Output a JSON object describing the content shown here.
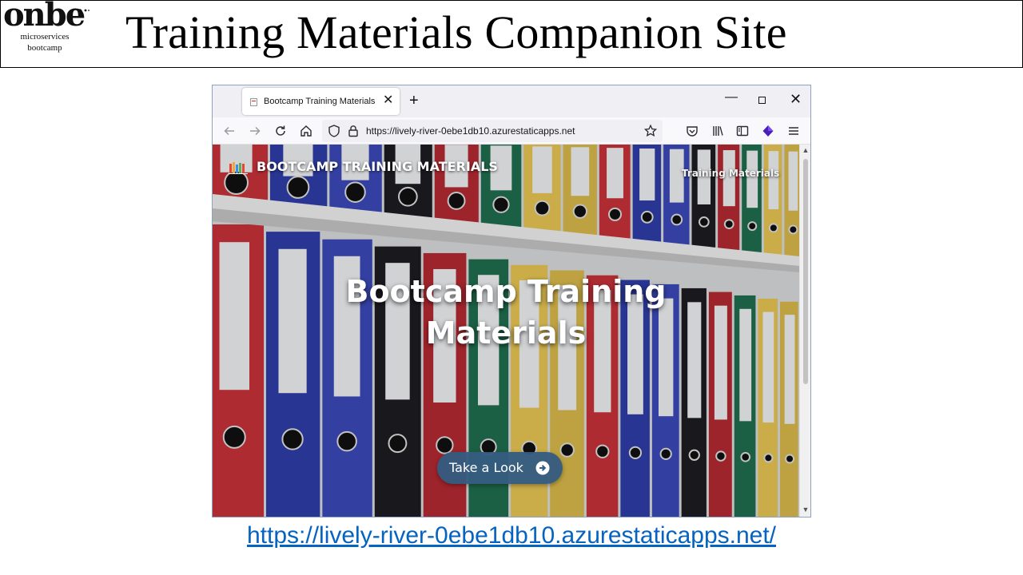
{
  "logo": {
    "wordmark": "onbe",
    "line1": "microservices",
    "line2": "bootcamp"
  },
  "slide": {
    "title": "Training Materials Companion Site",
    "link": "https://lively-river-0ebe1db10.azurestaticapps.net/"
  },
  "browser": {
    "tab_title": "Bootcamp Training Materials",
    "url": "https://lively-river-0ebe1db10.azurestaticapps.net"
  },
  "site": {
    "brand": "BOOTCAMP TRAINING MATERIALS",
    "nav_item": "Training Materials",
    "hero_line1": "Bootcamp Training",
    "hero_line2": "Materials",
    "cta_label": "Take a Look"
  },
  "colors": {
    "link": "#0563c1",
    "cta": "#355c80",
    "browser_chrome": "#f0f0f4"
  },
  "icons": {
    "tab": [
      "page-favicon-icon",
      "close-icon",
      "plus-icon"
    ],
    "window": [
      "minimize-icon",
      "maximize-icon",
      "close-icon"
    ],
    "nav": [
      "back-arrow-icon",
      "forward-arrow-icon",
      "reload-icon",
      "home-icon",
      "shield-icon",
      "lock-icon",
      "star-icon",
      "pocket-icon",
      "library-icon",
      "sidebar-icon",
      "extension-icon",
      "hamburger-menu-icon"
    ],
    "site": [
      "books-icon",
      "arrow-circle-right-icon"
    ]
  }
}
